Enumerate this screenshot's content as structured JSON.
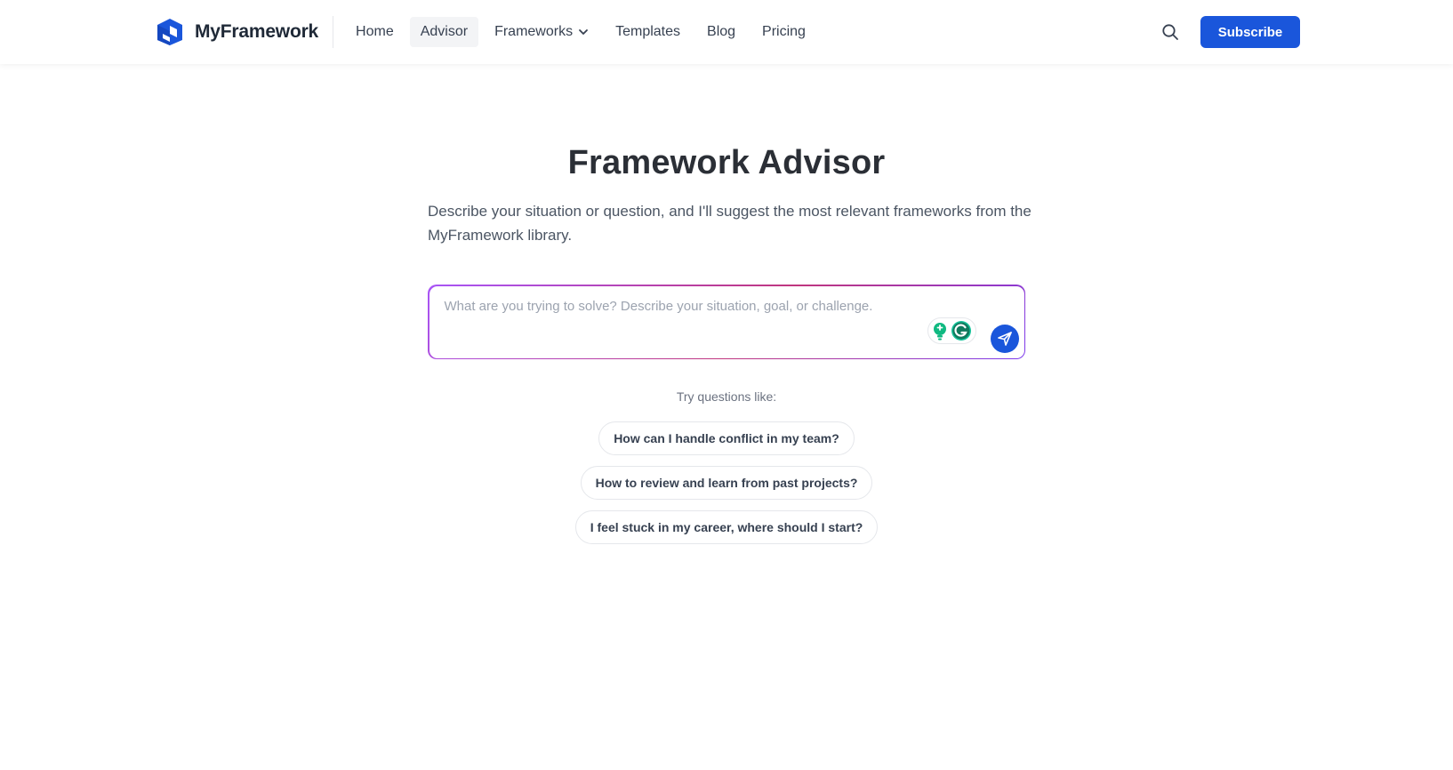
{
  "header": {
    "brand_name": "MyFramework",
    "nav": [
      {
        "label": "Home"
      },
      {
        "label": "Advisor",
        "active": true
      },
      {
        "label": "Frameworks",
        "has_dropdown": true
      },
      {
        "label": "Templates"
      },
      {
        "label": "Blog"
      },
      {
        "label": "Pricing"
      }
    ],
    "subscribe_label": "Subscribe",
    "icons": {
      "logo": "myframework-logo",
      "search": "search-icon",
      "dropdown": "chevron-down-icon"
    }
  },
  "main": {
    "title": "Framework Advisor",
    "subtitle": "Describe your situation or question, and I'll suggest the most relevant frameworks from the MyFramework library.",
    "input": {
      "value": "",
      "placeholder": "What are you trying to solve? Describe your situation, goal, or challenge."
    },
    "try_label": "Try questions like:",
    "suggestions": [
      "How can I handle conflict in my team?",
      "How to review and learn from past projects?",
      "I feel stuck in my career, where should I start?"
    ],
    "icons": {
      "idea": "lightbulb-icon",
      "grammar": "grammarly-icon",
      "send": "send-icon"
    }
  },
  "colors": {
    "primary": "#1a56db",
    "border_gradient_start": "#a855f7",
    "border_gradient_mid": "#c0367e",
    "assist_green": "#10b981",
    "grammarly_green": "#15c39a"
  }
}
